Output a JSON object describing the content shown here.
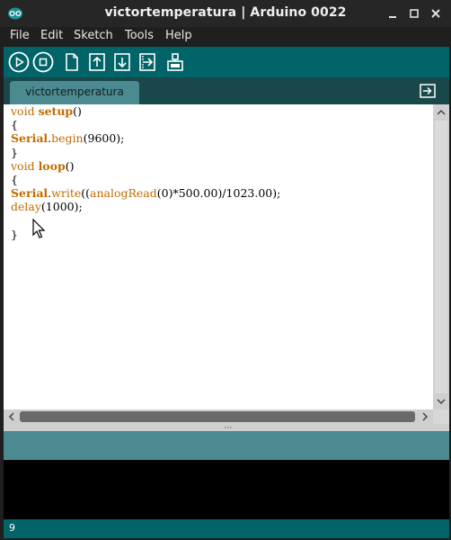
{
  "window": {
    "title": "victortemperatura | Arduino 0022"
  },
  "menu": [
    "File",
    "Edit",
    "Sketch",
    "Tools",
    "Help"
  ],
  "toolbar": {
    "icons": [
      "play-icon",
      "stop-icon",
      "new-icon",
      "open-icon",
      "save-icon",
      "upload-icon",
      "serial-monitor-icon"
    ]
  },
  "tabs": [
    {
      "label": "victortemperatura"
    }
  ],
  "editor": {
    "lines": [
      {
        "parts": [
          {
            "t": "void ",
            "c": "kw"
          },
          {
            "t": "setup",
            "c": "kw-b"
          },
          {
            "t": "()",
            "c": ""
          }
        ]
      },
      {
        "parts": [
          {
            "t": "{",
            "c": ""
          }
        ]
      },
      {
        "parts": [
          {
            "t": "Serial",
            "c": "kw-b"
          },
          {
            "t": ".",
            "c": ""
          },
          {
            "t": "begin",
            "c": "kw"
          },
          {
            "t": "(9600);",
            "c": ""
          }
        ]
      },
      {
        "parts": [
          {
            "t": "}",
            "c": ""
          }
        ]
      },
      {
        "parts": [
          {
            "t": "void ",
            "c": "kw"
          },
          {
            "t": "loop",
            "c": "kw-b"
          },
          {
            "t": "()",
            "c": ""
          }
        ]
      },
      {
        "parts": [
          {
            "t": "{",
            "c": ""
          }
        ]
      },
      {
        "parts": [
          {
            "t": "Serial",
            "c": "kw-b"
          },
          {
            "t": ".",
            "c": ""
          },
          {
            "t": "write",
            "c": "kw"
          },
          {
            "t": "((",
            "c": ""
          },
          {
            "t": "analogRead",
            "c": "kw"
          },
          {
            "t": "(0)*500.00)/1023.00);",
            "c": ""
          }
        ]
      },
      {
        "parts": [
          {
            "t": "delay",
            "c": "kw"
          },
          {
            "t": "(1000);",
            "c": ""
          }
        ]
      },
      {
        "parts": [
          {
            "t": "",
            "c": ""
          }
        ]
      },
      {
        "parts": [
          {
            "t": "}",
            "c": ""
          }
        ]
      }
    ]
  },
  "status": {
    "line_number": "9"
  },
  "colors": {
    "toolbar": "#006468",
    "tab": "#4c8a91",
    "keyword": "#c26b00",
    "console": "#000000"
  }
}
